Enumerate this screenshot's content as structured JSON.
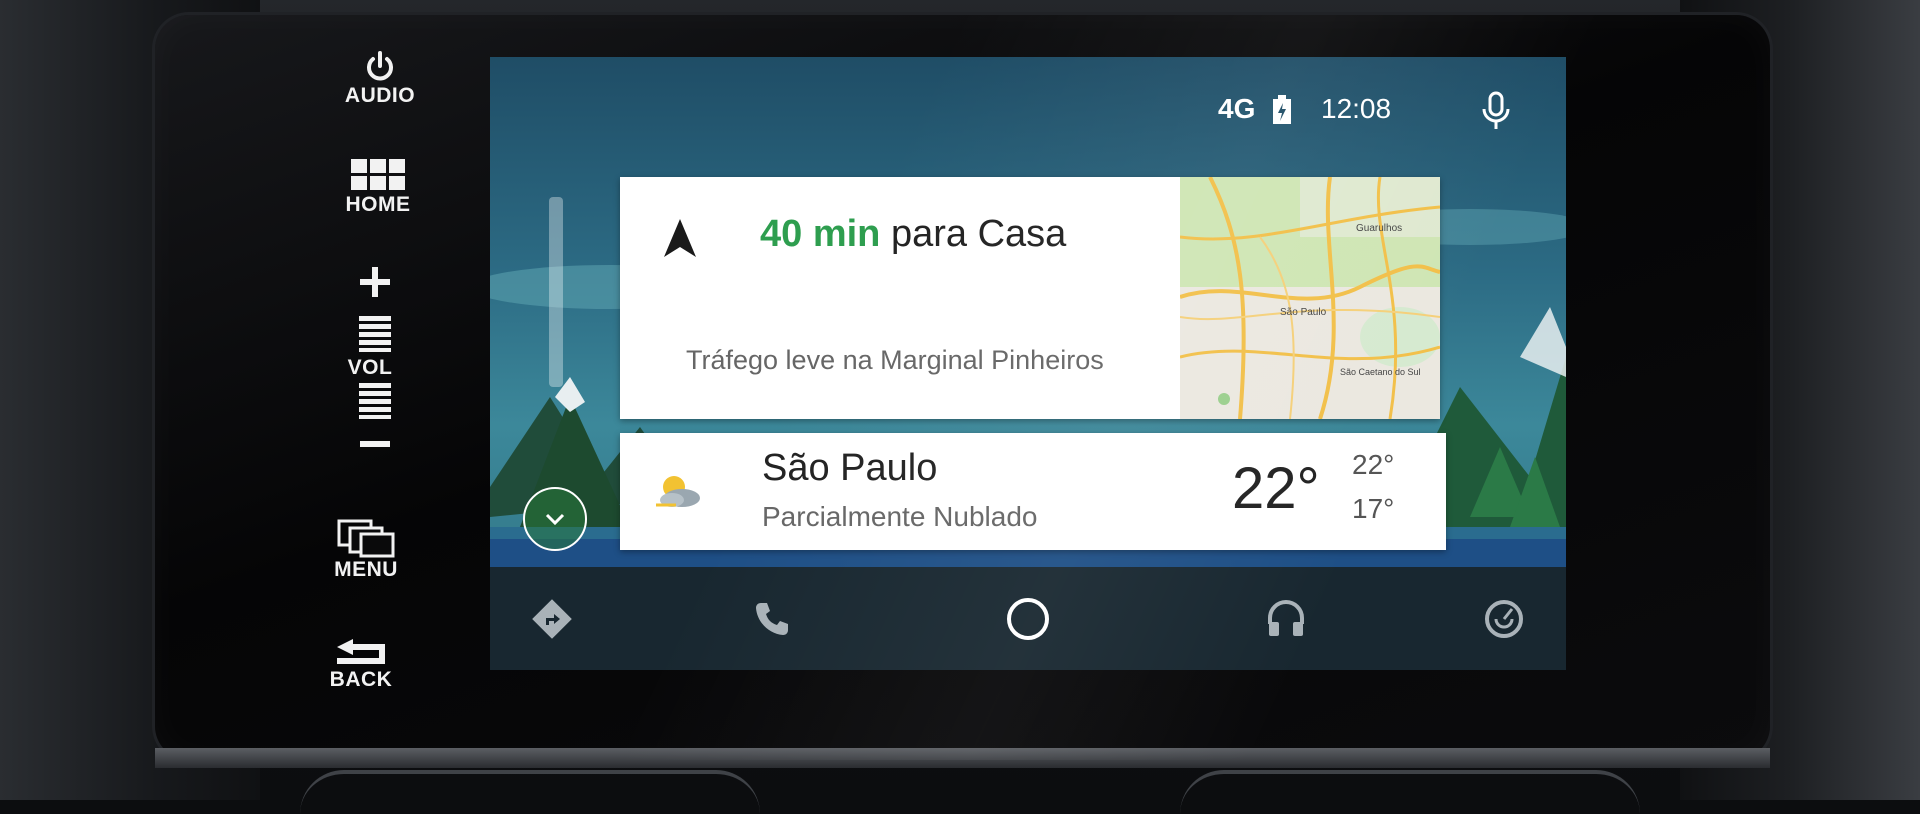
{
  "hardware_buttons": {
    "audio": "AUDIO",
    "home": "HOME",
    "volume": "VOL",
    "menu": "MENU",
    "back": "BACK"
  },
  "status_bar": {
    "network": "4G",
    "time": "12:08",
    "icons": [
      "battery-icon",
      "microphone-icon"
    ]
  },
  "navigation_card": {
    "eta": "40 min",
    "destination": "para Casa",
    "traffic": "Tráfego leve na Marginal Pinheiros",
    "icon": "navigation-arrow-icon",
    "map": {
      "labels": [
        "Guarulhos",
        "São Paulo",
        "São Caetano do Sul"
      ]
    },
    "eta_color": "#2e9e4f"
  },
  "weather_card": {
    "city": "São Paulo",
    "condition": "Parcialmente Nublado",
    "temperature": "22°",
    "high": "22°",
    "low": "17°",
    "icon": "partly-cloudy-icon"
  },
  "bottom_nav": {
    "items": [
      "navigation-icon",
      "phone-icon",
      "home-circle-icon",
      "headphones-icon",
      "exit-icon"
    ]
  },
  "expand_button": {
    "icon": "chevron-down-icon"
  }
}
